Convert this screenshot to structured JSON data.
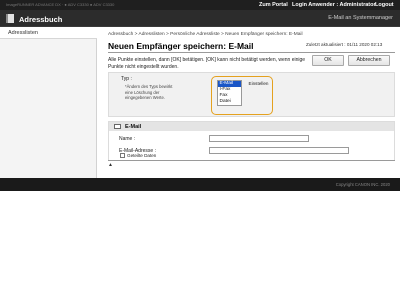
{
  "topbar": {
    "device": "ImageRUNNER ADVANCE DX · ● ADV C3330 ● ADV C3330",
    "portal": "Zum Portal",
    "login_user": "Login Anwender : Administrator",
    "logout": "Logout"
  },
  "titlebar": {
    "title": "Adressbuch",
    "system_link": "E-Mail an Systemmanager"
  },
  "sidebar": {
    "items": [
      {
        "label": "Adresslisten"
      }
    ]
  },
  "main": {
    "breadcrumb": "Adressbuch > Adresslisten > Persönliche Adressliste > Neuen Empfänger speichern: E-Mail",
    "title": "Neuen Empfänger speichern: E-Mail",
    "updated": "Zuletzt aktualisiert : 01/11 2020 02:13",
    "ok_label": "OK",
    "cancel_label": "Abbrechen",
    "instructions": "Alle Punkte einstellen, dann [OK] betätigen. [OK] kann nicht betätigt werden, wenn einige Punkte nicht eingestellt wurden."
  },
  "type_section": {
    "label": "Typ :",
    "note": "*Ändern des Typs bewirkt eine Löschung der eingegebenen Werte.",
    "options": [
      "E-Mail",
      "I-Fax",
      "Fax",
      "Datei"
    ],
    "selected_index": 0,
    "set_label": "Einstellen"
  },
  "email_section": {
    "header": "E-Mail",
    "name_label": "Name :",
    "name_value": "",
    "email_label": "E-Mail-Adresse :",
    "email_value": "",
    "shared_label": "Geteilte Daten"
  },
  "page_top_arrow": "▲",
  "footer": {
    "copyright": "Copyright CANON INC. 2020"
  },
  "colors": {
    "topbar": "#1f1f1f",
    "titlebar": "#2c2c2c",
    "highlight": "#e4a11f",
    "selection": "#1a56c7"
  }
}
